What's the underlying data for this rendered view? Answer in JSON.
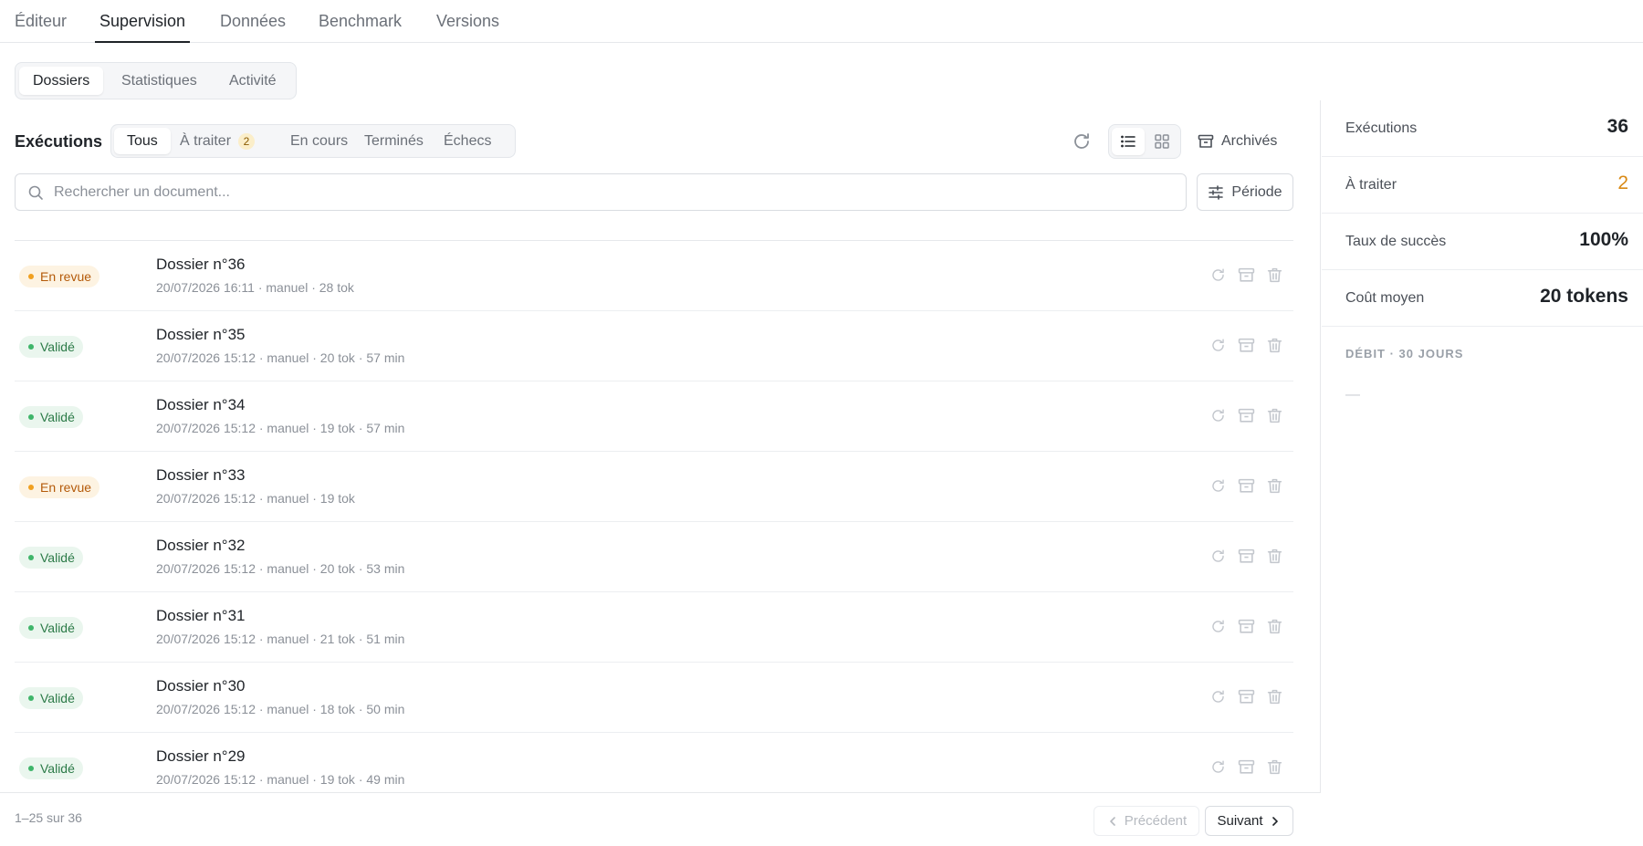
{
  "topnav": {
    "tabs": [
      "Éditeur",
      "Supervision",
      "Données",
      "Benchmark",
      "Versions"
    ],
    "active": 1
  },
  "subtabs": {
    "tabs": [
      "Dossiers",
      "Statistiques",
      "Activité"
    ],
    "active": 0
  },
  "executions": {
    "title": "Exécutions",
    "filters": [
      {
        "label": "Tous"
      },
      {
        "label": "À traiter",
        "count": "2"
      },
      {
        "label": "En cours"
      },
      {
        "label": "Terminés"
      },
      {
        "label": "Échecs"
      }
    ],
    "active_filter": 0,
    "archived_label": "Archivés",
    "view_mode": "list"
  },
  "search": {
    "placeholder": "Rechercher un document...",
    "value": ""
  },
  "period_label": "Période",
  "rows": [
    {
      "status": "En revue",
      "kind": "review",
      "title": "Dossier n°36",
      "meta": "20/07/2026 16:11 · manuel · 28 tok"
    },
    {
      "status": "Validé",
      "kind": "ok",
      "title": "Dossier n°35",
      "meta": "20/07/2026 15:12 · manuel · 20 tok · 57 min"
    },
    {
      "status": "Validé",
      "kind": "ok",
      "title": "Dossier n°34",
      "meta": "20/07/2026 15:12 · manuel · 19 tok · 57 min"
    },
    {
      "status": "En revue",
      "kind": "review",
      "title": "Dossier n°33",
      "meta": "20/07/2026 15:12 · manuel · 19 tok"
    },
    {
      "status": "Validé",
      "kind": "ok",
      "title": "Dossier n°32",
      "meta": "20/07/2026 15:12 · manuel · 20 tok · 53 min"
    },
    {
      "status": "Validé",
      "kind": "ok",
      "title": "Dossier n°31",
      "meta": "20/07/2026 15:12 · manuel · 21 tok · 51 min"
    },
    {
      "status": "Validé",
      "kind": "ok",
      "title": "Dossier n°30",
      "meta": "20/07/2026 15:12 · manuel · 18 tok · 50 min"
    },
    {
      "status": "Validé",
      "kind": "ok",
      "title": "Dossier n°29",
      "meta": "20/07/2026 15:12 · manuel · 19 tok · 49 min"
    }
  ],
  "pagination": {
    "info": "1–25 sur 36",
    "prev_label": "Précédent",
    "next_label": "Suivant"
  },
  "stats": [
    {
      "label": "Exécutions",
      "value": "36"
    },
    {
      "label": "À traiter",
      "value": "2",
      "tone": "warn"
    },
    {
      "label": "Taux de succès",
      "value": "100%"
    },
    {
      "label": "Coût moyen",
      "value": "20 tokens"
    }
  ],
  "debit": {
    "title": "DÉBIT · 30 JOURS",
    "empty": "—"
  },
  "colors": {
    "accent": "#1f2328",
    "review": "#f0a020",
    "valid": "#3fb56a",
    "warn_value": "#d98a16"
  }
}
